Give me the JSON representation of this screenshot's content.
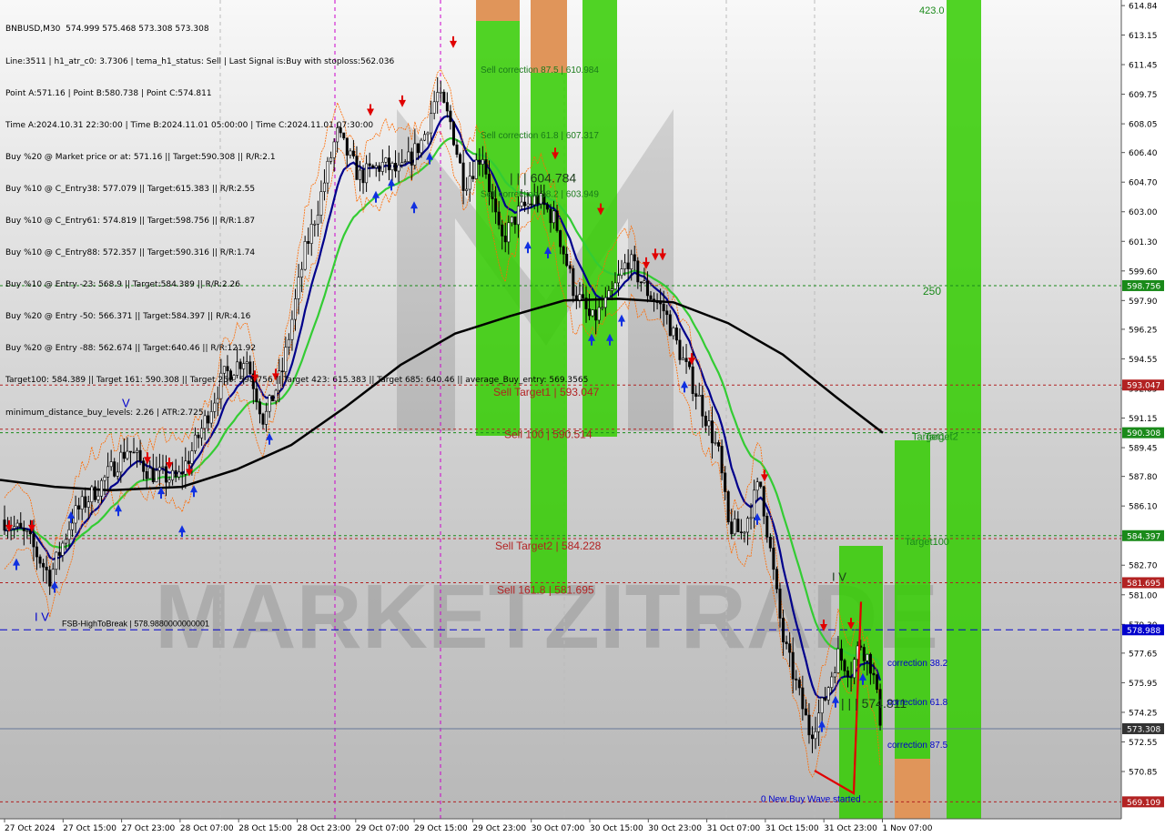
{
  "header": {
    "lines": [
      "BNBUSD,M30  574.999 575.468 573.308 573.308",
      "Line:3511 | h1_atr_c0: 3.7306 | tema_h1_status: Sell | Last Signal is:Buy with stoploss:562.036",
      "Point A:571.16 | Point B:580.738 | Point C:574.811",
      "Time A:2024.10.31 22:30:00 | Time B:2024.11.01 05:00:00 | Time C:2024.11.01 07:30:00",
      "Buy %20 @ Market price or at: 571.16 || Target:590.308 || R/R:2.1",
      "Buy %10 @ C_Entry38: 577.079 || Target:615.383 || R/R:2.55",
      "Buy %10 @ C_Entry61: 574.819 || Target:598.756 || R/R:1.87",
      "Buy %10 @ C_Entry88: 572.357 || Target:590.316 || R/R:1.74",
      "Buy %10 @ Entry -23: 568.9 || Target:584.389 || R/R:2.26",
      "Buy %20 @ Entry -50: 566.371 || Target:584.397 || R/R:4.16",
      "Buy %20 @ Entry -88: 562.674 || Target:640.46 || R/R:121.92",
      "Target100: 584.389 || Target 161: 590.308 || Target 250: 598.756 || Target 423: 615.383 || Target 685: 640.46 || average_Buy_entry: 569.3565",
      "minimum_distance_buy_levels: 2.26 | ATR:2.725"
    ]
  },
  "watermark": "MARKETZITRADE",
  "colors": {
    "green_zone": "#33cc00",
    "orange_zone": "#e0955a",
    "red_level": "#b22222",
    "green_level": "#1a8a1a",
    "blue_level": "#0000cc",
    "ma_black": "#000000",
    "ma_navy": "#00008b",
    "ma_green": "#33cc33",
    "channel_orange": "#ff6a00"
  },
  "chart_data": {
    "type": "candlestick",
    "symbol": "BNBUSD",
    "timeframe": "M30",
    "ylim": [
      568.5,
      614.9
    ],
    "y_ticks": [
      614.84,
      613.15,
      611.45,
      609.75,
      608.05,
      606.4,
      604.7,
      603.0,
      601.3,
      599.6,
      597.9,
      596.25,
      594.55,
      592.85,
      591.15,
      589.45,
      587.8,
      586.1,
      584.4,
      582.7,
      581.0,
      579.3,
      577.65,
      575.95,
      574.25,
      572.55,
      570.85
    ],
    "x_ticks": [
      "27 Oct 2024",
      "27 Oct 15:00",
      "27 Oct 23:00",
      "28 Oct 07:00",
      "28 Oct 15:00",
      "28 Oct 23:00",
      "29 Oct 07:00",
      "29 Oct 15:00",
      "29 Oct 23:00",
      "30 Oct 07:00",
      "30 Oct 15:00",
      "30 Oct 23:00",
      "31 Oct 07:00",
      "31 Oct 15:00",
      "31 Oct 23:00",
      "1 Nov 07:00"
    ],
    "price_labels": [
      {
        "value": 598.756,
        "text": "598.756",
        "color": "#1a8a1a"
      },
      {
        "value": 593.047,
        "text": "593.047",
        "color": "#b22222"
      },
      {
        "value": 590.308,
        "text": "590.308",
        "color": "#1a8a1a"
      },
      {
        "value": 584.397,
        "text": "584.397",
        "color": "#1a8a1a"
      },
      {
        "value": 581.695,
        "text": "581.695",
        "color": "#b22222"
      },
      {
        "value": 578.988,
        "text": "578.988",
        "color": "#0000cc"
      },
      {
        "value": 573.308,
        "text": "573.308",
        "color": "#333333"
      },
      {
        "value": 569.109,
        "text": "569.109",
        "color": "#b22222"
      }
    ],
    "levels": [
      {
        "value": 598.756,
        "color": "#1a8a1a",
        "style": "dotted"
      },
      {
        "value": 593.047,
        "color": "#b22222",
        "style": "dotted"
      },
      {
        "value": 590.514,
        "color": "#b22222",
        "style": "dotted"
      },
      {
        "value": 590.308,
        "color": "#1a8a1a",
        "style": "dotted"
      },
      {
        "value": 584.397,
        "color": "#1a8a1a",
        "style": "dotted"
      },
      {
        "value": 584.228,
        "color": "#b22222",
        "style": "dotted"
      },
      {
        "value": 581.695,
        "color": "#b22222",
        "style": "dotted"
      },
      {
        "value": 578.988,
        "color": "#0000cc",
        "style": "dashed"
      },
      {
        "value": 573.308,
        "color": "#667799",
        "style": "solid"
      },
      {
        "value": 569.109,
        "color": "#b22222",
        "style": "dotted"
      }
    ],
    "annotations": [
      {
        "text": "Sell correction 87.5 | 610.984",
        "value": 610.984,
        "color": "#1a7a1a"
      },
      {
        "text": "| | | 604.784",
        "value": 604.784,
        "color": "#1a3a1a"
      },
      {
        "text": "Sell correction 61.8 | 607.317",
        "value": 607.317,
        "color": "#1a7a1a"
      },
      {
        "text": "Sell correction 38.2 | 603.949",
        "value": 603.949,
        "color": "#1a7a1a"
      },
      {
        "text": "Sell Target1 | 593.047",
        "value": 593.047,
        "color": "#b22222"
      },
      {
        "text": "Sell 100 | 590.514",
        "value": 590.514,
        "color": "#b22222"
      },
      {
        "text": "Sell Target2 | 584.228",
        "value": 584.228,
        "color": "#b22222"
      },
      {
        "text": "Sell 161.8 | 581.695",
        "value": 581.695,
        "color": "#b22222"
      },
      {
        "text": "FSB-HighToBreak | 578.9880000000001",
        "value": 578.988,
        "color": "#000000"
      },
      {
        "text": "| | | 574.811",
        "value": 574.811,
        "color": "#1a3a1a"
      },
      {
        "text": "correction 38.2",
        "value": 577.079,
        "color": "#0000cc"
      },
      {
        "text": "correction 61.8",
        "value": 574.819,
        "color": "#0000cc"
      },
      {
        "text": "correction 87.5",
        "value": 572.357,
        "color": "#0000cc"
      },
      {
        "text": "0 New Buy Wave started",
        "value": 569.2,
        "color": "#0000cc"
      },
      {
        "text": "Target1",
        "value": 590.308,
        "color": "#1a8a1a"
      },
      {
        "text": "Target2",
        "value": 590.308,
        "color": "#1a8a1a"
      },
      {
        "text": "Target100",
        "value": 584.389,
        "color": "#1a8a1a"
      },
      {
        "text": "250",
        "value": 598.756,
        "color": "#1a8a1a"
      },
      {
        "text": "423.0",
        "value": 614.7,
        "color": "#1a8a1a"
      },
      {
        "text": "V",
        "value": 592.0,
        "color": "#0000cc"
      },
      {
        "text": "I V",
        "value": 579.7,
        "color": "#0000cc"
      },
      {
        "text": "I V",
        "value": 582.0,
        "color": "#1a3a1a"
      }
    ]
  }
}
